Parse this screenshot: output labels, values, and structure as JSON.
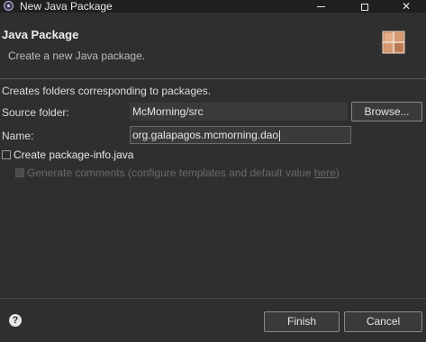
{
  "window": {
    "title": "New Java Package",
    "icon": "eclipse-icon"
  },
  "header": {
    "title": "Java Package",
    "subtitle": "Create a new Java package.",
    "graphic": "package-wizard-icon"
  },
  "form": {
    "description": "Creates folders corresponding to packages.",
    "source_folder_label": "Source folder:",
    "source_folder_value": "McMorning/src",
    "browse_label": "Browse...",
    "name_label": "Name:",
    "name_value": "org.galapagos.mcmorning.dao",
    "create_package_info_label": "Create package-info.java",
    "create_package_info_checked": false,
    "generate_comments_label": "Generate comments (configure templates and default value ",
    "generate_comments_link": "here",
    "generate_comments_suffix": ")",
    "generate_comments_checked": false,
    "generate_comments_enabled": false
  },
  "footer": {
    "help_icon": "help-icon",
    "finish_label": "Finish",
    "cancel_label": "Cancel"
  },
  "colors": {
    "background": "#2f2f2f",
    "titlebar": "#1f1f1f",
    "text": "#dcdcdc",
    "disabled_text": "#6a6a6a"
  }
}
